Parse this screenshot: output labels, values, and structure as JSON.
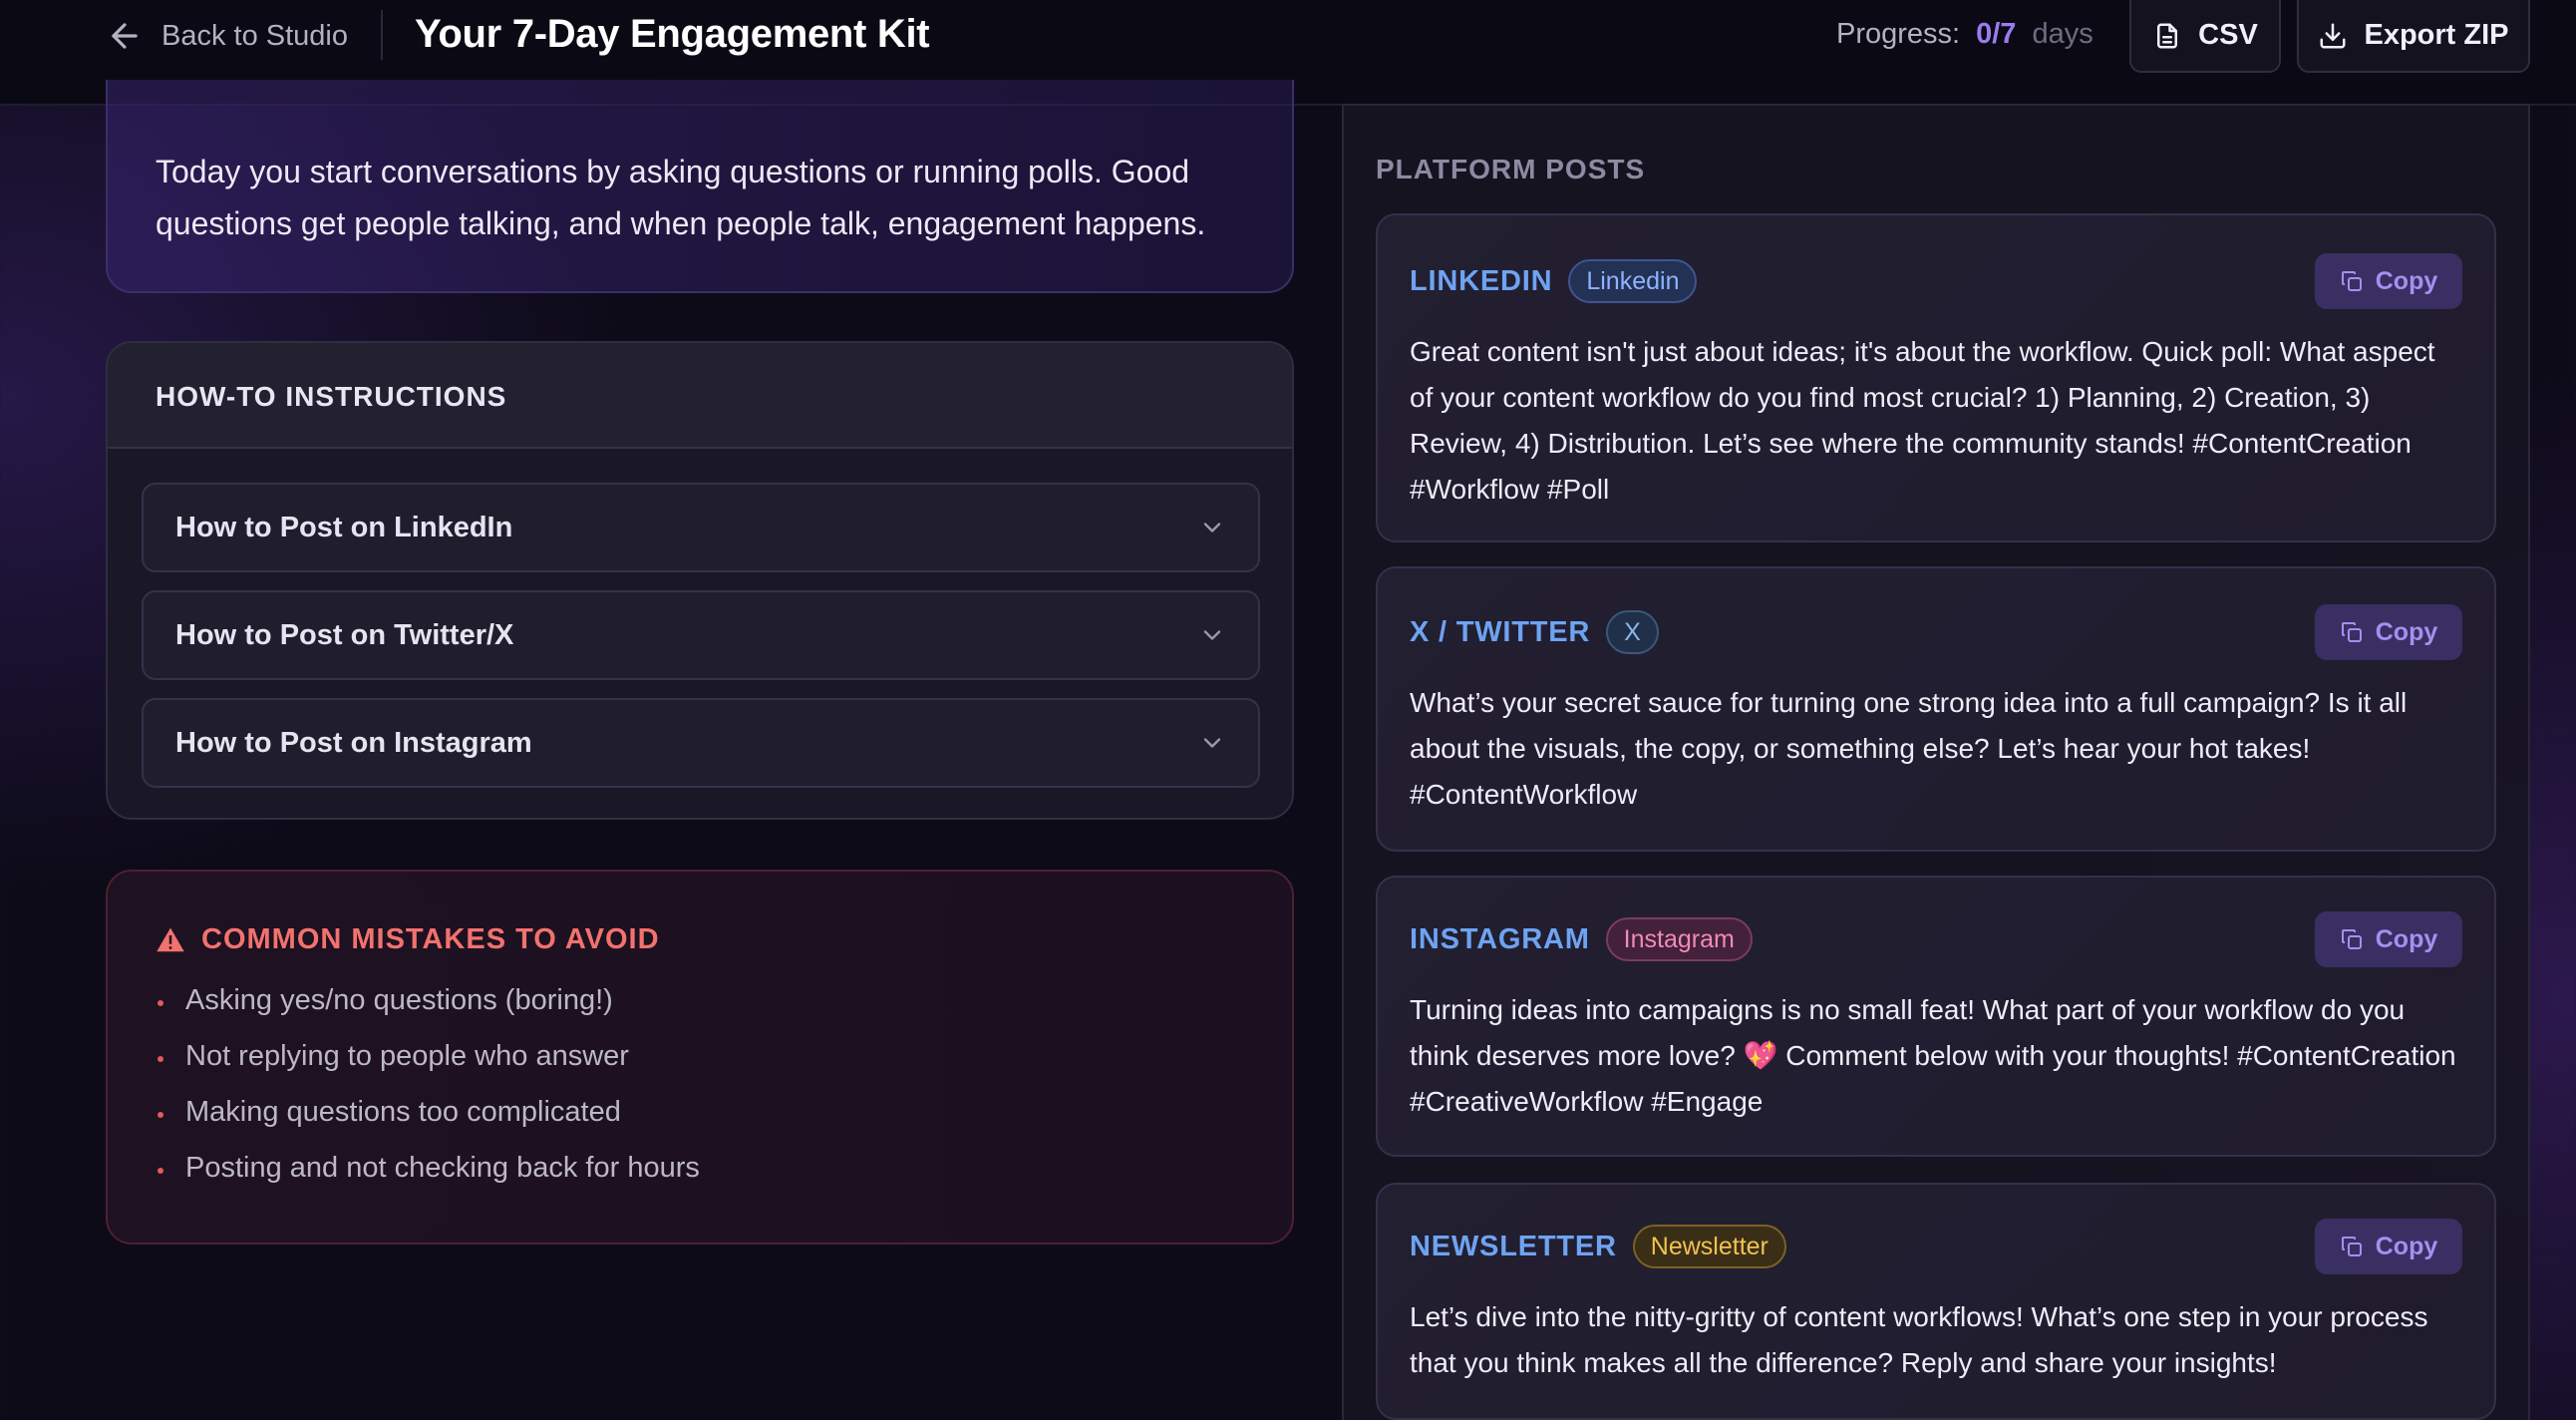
{
  "header": {
    "back_label": "Back to Studio",
    "title": "Your 7-Day Engagement Kit",
    "progress_label": "Progress:",
    "progress_value": "0/7",
    "progress_unit": "days",
    "csv_label": "CSV",
    "export_label": "Export ZIP"
  },
  "intro": {
    "text": "Today you start conversations by asking questions or running polls. Good questions get people talking, and when people talk, engagement happens."
  },
  "howto": {
    "title": "HOW-TO INSTRUCTIONS",
    "items": [
      {
        "label": "How to Post on LinkedIn"
      },
      {
        "label": "How to Post on Twitter/X"
      },
      {
        "label": "How to Post on Instagram"
      }
    ]
  },
  "mistakes": {
    "title": "COMMON MISTAKES TO AVOID",
    "items": [
      "Asking yes/no questions (boring!)",
      "Not replying to people who answer",
      "Making questions too complicated",
      "Posting and not checking back for hours"
    ]
  },
  "posts": {
    "section_label": "PLATFORM POSTS",
    "copy_label": "Copy",
    "items": [
      {
        "platform": "LINKEDIN",
        "tag": "Linkedin",
        "tag_color": "#8db4ff",
        "body": "Great content isn't just about ideas; it's about the workflow. Quick poll: What aspect of your content workflow do you find most crucial? 1) Planning, 2) Creation, 3) Review, 4) Distribution. Let’s see where the community stands! #ContentCreation #Workflow #Poll"
      },
      {
        "platform": "X / TWITTER",
        "tag": "X",
        "tag_color": "#8ab6e6",
        "body": "What’s your secret sauce for turning one strong idea into a full campaign? Is it all about the visuals, the copy, or something else? Let’s hear your hot takes! #ContentWorkflow"
      },
      {
        "platform": "INSTAGRAM",
        "tag": "Instagram",
        "tag_color": "#f08ab9",
        "body": "Turning ideas into campaigns is no small feat! What part of your workflow do you think deserves more love? 💖 Comment below with your thoughts! #ContentCreation #CreativeWorkflow #Engage"
      },
      {
        "platform": "NEWSLETTER",
        "tag": "Newsletter",
        "tag_color": "#f2c351",
        "body": "Let’s dive into the nitty-gritty of content workflows! What’s one step in your process that you think makes all the difference? Reply and share your insights!"
      }
    ]
  },
  "colors": {
    "accent": "#9b7cf0",
    "platform": "#6ea3f2",
    "warning": "#f2726e"
  }
}
